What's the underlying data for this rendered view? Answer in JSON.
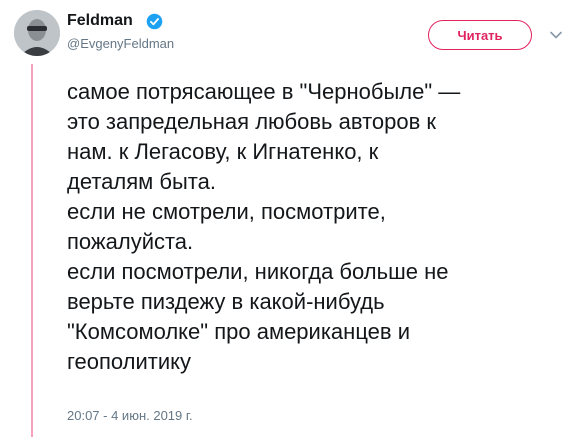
{
  "user": {
    "display_name": "Feldman",
    "handle": "@EvgenyFeldman",
    "verified": true
  },
  "follow_button": {
    "label": "Читать"
  },
  "more_icon": "chevron-down-icon",
  "tweet": {
    "lines": [
      "самое потрясающее в \"Чернобыле\" —",
      "это запредельная любовь авторов к",
      "нам. к Легасову, к Игнатенко, к",
      "деталям быта.",
      "если не смотрели, посмотрите,",
      "пожалуйста.",
      "если посмотрели, никогда больше не",
      "верьте пиздежу в какой-нибудь",
      "\"Комсомолке\" про американцев и",
      "геополитику"
    ],
    "timestamp": "20:07 - 4 июн. 2019 г."
  },
  "colors": {
    "accent": "#e0245e",
    "thread_line": "#f4a0c0",
    "verified_blue": "#1da1f2",
    "muted_text": "#657786"
  }
}
